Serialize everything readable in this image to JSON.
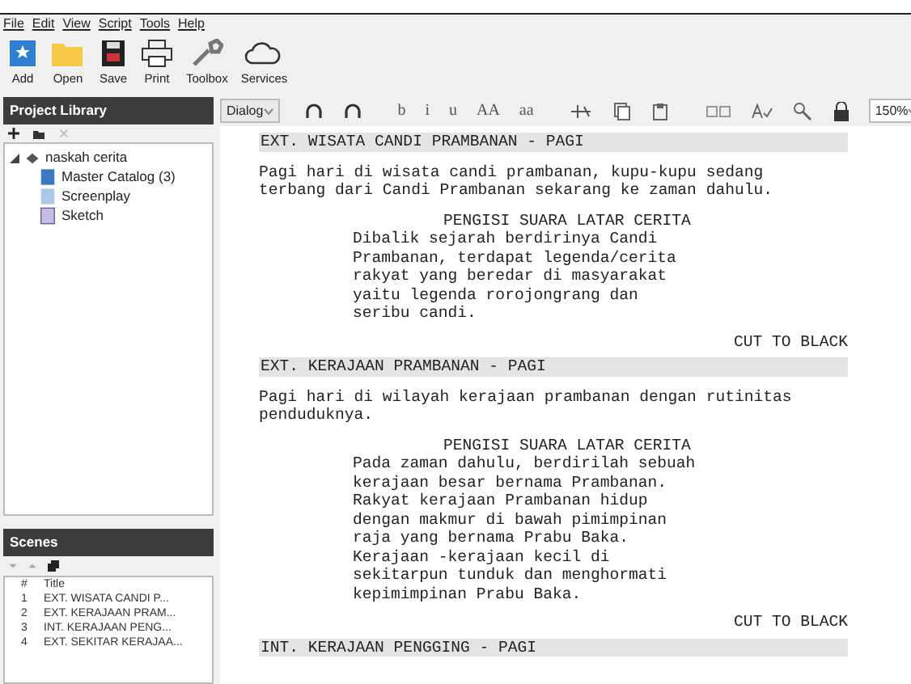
{
  "menu": [
    "File",
    "Edit",
    "View",
    "Script",
    "Tools",
    "Help"
  ],
  "toolbar": [
    {
      "kind": "add",
      "label": "Add"
    },
    {
      "kind": "open",
      "label": "Open"
    },
    {
      "kind": "save",
      "label": "Save"
    },
    {
      "kind": "print",
      "label": "Print"
    },
    {
      "kind": "toolbox",
      "label": "Toolbox"
    },
    {
      "kind": "services",
      "label": "Services"
    }
  ],
  "project_library": {
    "title": "Project Library",
    "tree": [
      {
        "label": "naskah cerita",
        "expanded": true,
        "children": [
          {
            "label": "Master Catalog (3)",
            "kind": "catalog"
          },
          {
            "label": "Screenplay",
            "kind": "screenplay"
          },
          {
            "label": "Sketch",
            "kind": "sketch"
          }
        ]
      }
    ]
  },
  "scenes": {
    "title": "Scenes",
    "columns": [
      "#",
      "Title"
    ],
    "rows": [
      [
        "1",
        "EXT. WISATA CANDI P..."
      ],
      [
        "2",
        "EXT. KERAJAAN PRAM..."
      ],
      [
        "3",
        "INT. KERAJAAN PENG..."
      ],
      [
        "4",
        "EXT. SEKITAR KERAJAA..."
      ]
    ]
  },
  "format_toolbar": {
    "element_type": "Dialog",
    "zoom": "150%",
    "buttons": [
      {
        "kind": "undo"
      },
      {
        "kind": "redo"
      },
      {
        "kind": "sep"
      },
      {
        "kind": "text",
        "label": "b"
      },
      {
        "kind": "text",
        "label": "i"
      },
      {
        "kind": "text",
        "label": "u"
      },
      {
        "kind": "text",
        "label": "AA"
      },
      {
        "kind": "text",
        "label": "aa"
      },
      {
        "kind": "sep"
      },
      {
        "kind": "cut"
      },
      {
        "kind": "copy"
      },
      {
        "kind": "paste"
      },
      {
        "kind": "sep"
      },
      {
        "kind": "link"
      },
      {
        "kind": "spell"
      },
      {
        "kind": "find"
      },
      {
        "kind": "lock"
      }
    ]
  },
  "script": [
    {
      "kind": "scene",
      "lines": [
        "EXT. WISATA CANDI PRAMBANAN - PAGI"
      ]
    },
    {
      "kind": "action",
      "lines": [
        "Pagi hari di wisata candi prambanan, kupu-kupu sedang",
        "terbang dari Candi Prambanan sekarang ke zaman dahulu."
      ]
    },
    {
      "kind": "character",
      "lines": [
        "PENGISI SUARA LATAR CERITA"
      ]
    },
    {
      "kind": "dialogue",
      "lines": [
        "Dibalik sejarah berdirinya Candi",
        "Prambanan, terdapat legenda/cerita",
        "rakyat yang beredar di masyarakat",
        "yaitu legenda rorojongrang dan",
        "seribu candi."
      ]
    },
    {
      "kind": "transition",
      "lines": [
        "CUT TO BLACK"
      ]
    },
    {
      "kind": "scene",
      "lines": [
        "EXT. KERAJAAN PRAMBANAN - PAGI"
      ]
    },
    {
      "kind": "action",
      "lines": [
        "Pagi hari di wilayah kerajaan prambanan dengan rutinitas",
        "penduduknya."
      ]
    },
    {
      "kind": "character",
      "lines": [
        "PENGISI SUARA LATAR CERITA"
      ]
    },
    {
      "kind": "dialogue",
      "lines": [
        "Pada zaman dahulu, berdirilah sebuah",
        "kerajaan besar bernama Prambanan.",
        "Rakyat kerajaan Prambanan hidup",
        "dengan makmur di bawah pimimpinan",
        "raja yang bernama Prabu Baka.",
        "Kerajaan -kerajaan kecil di",
        "sekitarpun tunduk dan menghormati",
        "kepimimpinan Prabu Baka."
      ]
    },
    {
      "kind": "transition",
      "lines": [
        "CUT TO BLACK"
      ]
    },
    {
      "kind": "scene",
      "lines": [
        "INT. KERAJAAN PENGGING - PAGI"
      ]
    }
  ]
}
